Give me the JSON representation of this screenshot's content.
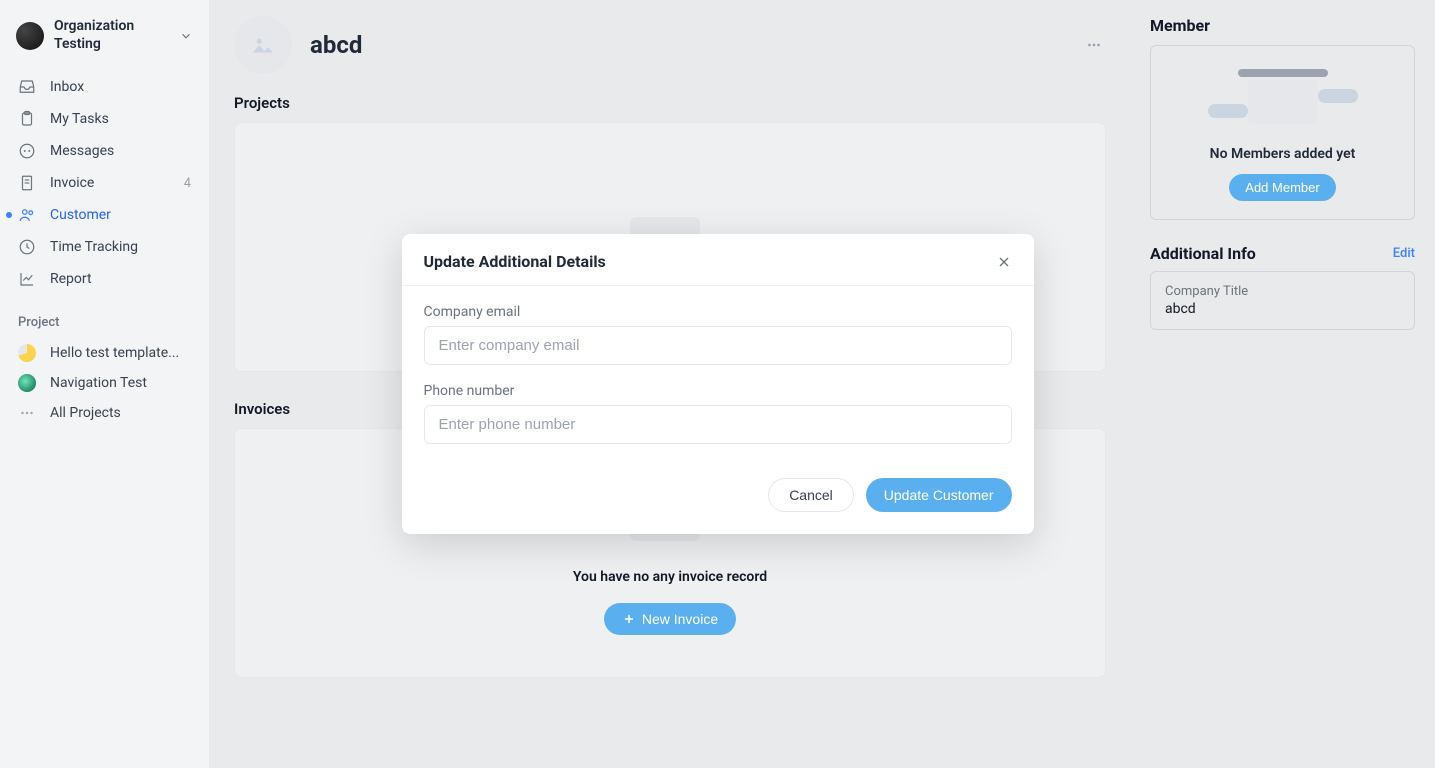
{
  "org": {
    "name": "Organization Testing"
  },
  "nav": {
    "inbox": "Inbox",
    "my_tasks": "My Tasks",
    "messages": "Messages",
    "invoice": "Invoice",
    "invoice_badge": "4",
    "customer": "Customer",
    "time_tracking": "Time Tracking",
    "report": "Report"
  },
  "project_section": "Project",
  "projects": {
    "p1": "Hello test template...",
    "p2": "Navigation Test",
    "all": "All Projects"
  },
  "customer": {
    "name": "abcd",
    "projects_title": "Projects",
    "invoices_title": "Invoices",
    "no_invoice_text": "You have no any invoice record",
    "new_invoice_btn": "New Invoice"
  },
  "right": {
    "member_title": "Member",
    "no_members_text": "No Members added yet",
    "add_member_btn": "Add Member",
    "additional_info_title": "Additional Info",
    "edit_link": "Edit",
    "company_title_label": "Company Title",
    "company_title_value": "abcd"
  },
  "modal": {
    "title": "Update Additional Details",
    "company_email_label": "Company email",
    "company_email_placeholder": "Enter company email",
    "company_email_value": "",
    "phone_label": "Phone number",
    "phone_placeholder": "Enter phone number",
    "phone_value": "",
    "cancel_btn": "Cancel",
    "update_btn": "Update Customer"
  }
}
